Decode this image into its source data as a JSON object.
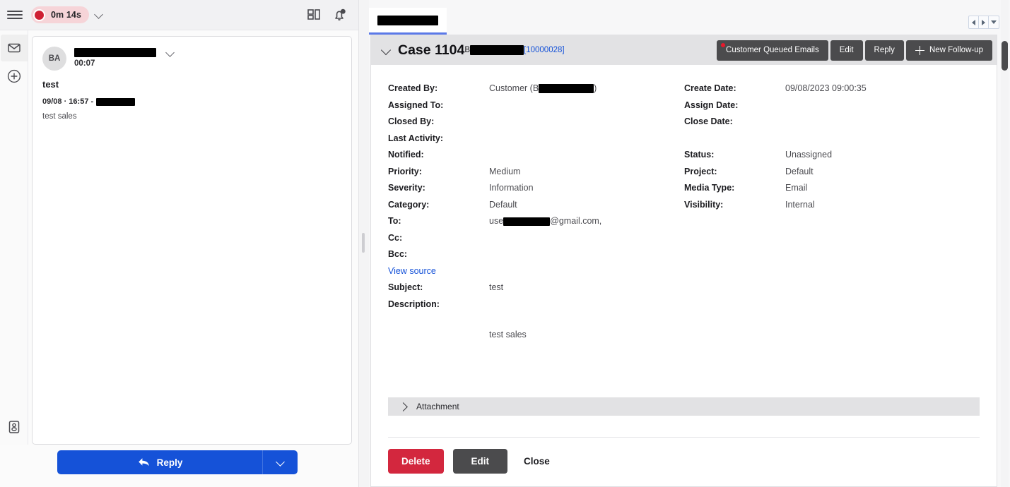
{
  "left": {
    "topbar": {
      "menu_icon": "hamburger-icon",
      "timer_label": "0m 14s",
      "timer_dot_color": "#cf2033",
      "timer_bg_color": "#f6d4d8",
      "dropdown_icon": "chevron-down-icon",
      "dashboard_icon": "dashboard-icon",
      "notifications_icon": "bell-icon"
    },
    "rail": {
      "items": [
        {
          "icon": "envelope-icon",
          "active": true
        },
        {
          "icon": "plus-circle-icon",
          "active": false
        }
      ],
      "bottom_icon": "contact-card-icon"
    },
    "conversation": {
      "avatar_initials": "BA",
      "sender_name_redacted": true,
      "time": "00:07",
      "subject": "test",
      "meta_prefix": "09/08 · 16:57 -",
      "meta_name_redacted": true,
      "body": "test sales",
      "expand_icon": "chevron-down-icon"
    },
    "reply_button": {
      "label": "Reply",
      "icon": "reply-arrow-icon",
      "dropdown_icon": "chevron-down-icon",
      "color": "#1552d8"
    }
  },
  "right": {
    "tabbar": {
      "paren": "(",
      "tab_label_redacted": true,
      "tab_active_color": "#5b79e8",
      "nav": {
        "prev_icon": "triangle-left-icon",
        "next_icon": "triangle-right-icon",
        "more_icon": "triangle-down-icon"
      }
    },
    "case": {
      "collapse_icon": "chevron-down-icon",
      "title": "Case 1104",
      "ref_prefix": "B",
      "ref_redacted": true,
      "ref_number": "[10000028]",
      "actions": [
        {
          "label": "Customer Queued Emails",
          "badge": true,
          "name": "customer-queued-emails-button"
        },
        {
          "label": "Edit",
          "badge": false,
          "name": "edit-button"
        },
        {
          "label": "Reply",
          "badge": false,
          "name": "reply-button"
        },
        {
          "label": "New Follow-up",
          "badge": false,
          "icon": "plus-icon",
          "name": "new-follow-up-button"
        }
      ],
      "fields_left": [
        {
          "label": "Created By:",
          "value": "Customer (B",
          "value_suffix": ")",
          "redacted": true
        },
        {
          "label": "Assigned To:",
          "value": ""
        },
        {
          "label": "Closed By:",
          "value": ""
        },
        {
          "label": "Last Activity:",
          "value": ""
        },
        {
          "label": "Notified:",
          "value": ""
        },
        {
          "label": "Priority:",
          "value": "Medium"
        },
        {
          "label": "Severity:",
          "value": "Information"
        },
        {
          "label": "Category:",
          "value": "Default"
        }
      ],
      "fields_right": [
        {
          "label": "Create Date:",
          "value": "09/08/2023 09:00:35"
        },
        {
          "label": "Assign Date:",
          "value": ""
        },
        {
          "label": "Close Date:",
          "value": ""
        },
        {
          "label": "",
          "value": ""
        },
        {
          "label": "Status:",
          "value": "Unassigned"
        },
        {
          "label": "Project:",
          "value": "Default"
        },
        {
          "label": "Media Type:",
          "value": "Email"
        },
        {
          "label": "Visibility:",
          "value": "Internal"
        }
      ],
      "email": {
        "to_label": "To:",
        "to_prefix": "use",
        "to_suffix": "@gmail.com,",
        "to_redacted": true,
        "cc_label": "Cc:",
        "cc_value": "",
        "bcc_label": "Bcc:",
        "bcc_value": "",
        "view_source": "View source",
        "subject_label": "Subject:",
        "subject_value": "test",
        "description_label": "Description:",
        "description_body": "test sales"
      },
      "attachment": {
        "label": "Attachment",
        "expand_icon": "chevron-right-icon"
      },
      "footer": {
        "delete_label": "Delete",
        "edit_label": "Edit",
        "close_label": "Close",
        "delete_color": "#d3273e",
        "edit_color": "#4b4b4d"
      }
    }
  }
}
